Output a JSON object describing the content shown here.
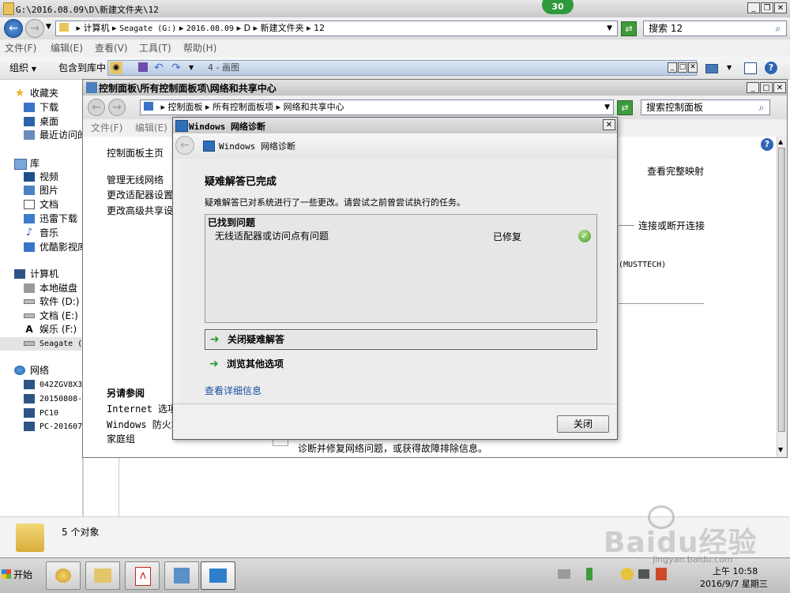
{
  "outer_window": {
    "title": "G:\\2016.08.09\\D\\新建文件夹\\12",
    "badge": "30",
    "address": {
      "segments": [
        "计算机",
        "Seagate (G:)",
        "2016.08.09",
        "D",
        "新建文件夹",
        "12"
      ]
    },
    "search": {
      "value": "搜索 12"
    },
    "menu": [
      "文件(F)",
      "编辑(E)",
      "查看(V)",
      "工具(T)",
      "帮助(H)"
    ],
    "toolbar": {
      "organize": "组织",
      "include_in_library": "包含到库中",
      "paint_label": "4 - 画图"
    }
  },
  "sidebar": {
    "favorites": {
      "label": "收藏夹",
      "items": [
        "下载",
        "桌面",
        "最近访问的"
      ]
    },
    "library": {
      "label": "库",
      "items": [
        "视频",
        "图片",
        "文档",
        "迅雷下载",
        "音乐",
        "优酷影视库"
      ]
    },
    "computer": {
      "label": "计算机",
      "items": [
        "本地磁盘",
        "软件 (D:)",
        "文档 (E:)",
        "娱乐 (F:)",
        "Seagate ("
      ]
    },
    "network": {
      "label": "网络",
      "items": [
        "042ZGV8X3",
        "20150808-",
        "PC10",
        "PC-201607"
      ]
    }
  },
  "status": {
    "count": "5 个对象"
  },
  "taskbar": {
    "start": "开始",
    "clock_time": "上午 10:58",
    "clock_date": "2016/9/7 星期三"
  },
  "control_panel": {
    "title": "控制面板\\所有控制面板项\\网络和共享中心",
    "address": {
      "segments": [
        "控制面板",
        "所有控制面板项",
        "网络和共享中心"
      ]
    },
    "search": {
      "value": "搜索控制面板"
    },
    "menu": [
      "文件(F)",
      "编辑(E)"
    ],
    "left_links": [
      "控制面板主页",
      "管理无线网络",
      "更改适配器设置",
      "更改高级共享设"
    ],
    "see_also": {
      "heading": "另请参阅",
      "items": [
        "Internet 选项",
        "Windows 防火墙",
        "家庭组"
      ]
    },
    "right_links": {
      "view_map": "查看完整映射",
      "connect": "连接或断开连接",
      "machine": "(MUSTTECH)"
    },
    "bottom_text": "诊断并修复网络问题，或获得故障排除信息。"
  },
  "dialog": {
    "title": "Windows 网络诊断",
    "header": "Windows 网络诊断",
    "heading": "疑难解答已完成",
    "description": "疑难解答已对系统进行了一些更改。请尝试之前曾尝试执行的任务。",
    "problems": {
      "heading": "已找到问题",
      "rows": [
        {
          "issue": "无线适配器或访问点有问题",
          "status": "已修复"
        }
      ]
    },
    "close_troubleshooter": "关闭疑难解答",
    "explore_options": "浏览其他选项",
    "details_link": "查看详细信息",
    "close_button": "关闭"
  },
  "watermark": {
    "text": "Baidu经验",
    "url": "jingyan.baidu.com"
  }
}
